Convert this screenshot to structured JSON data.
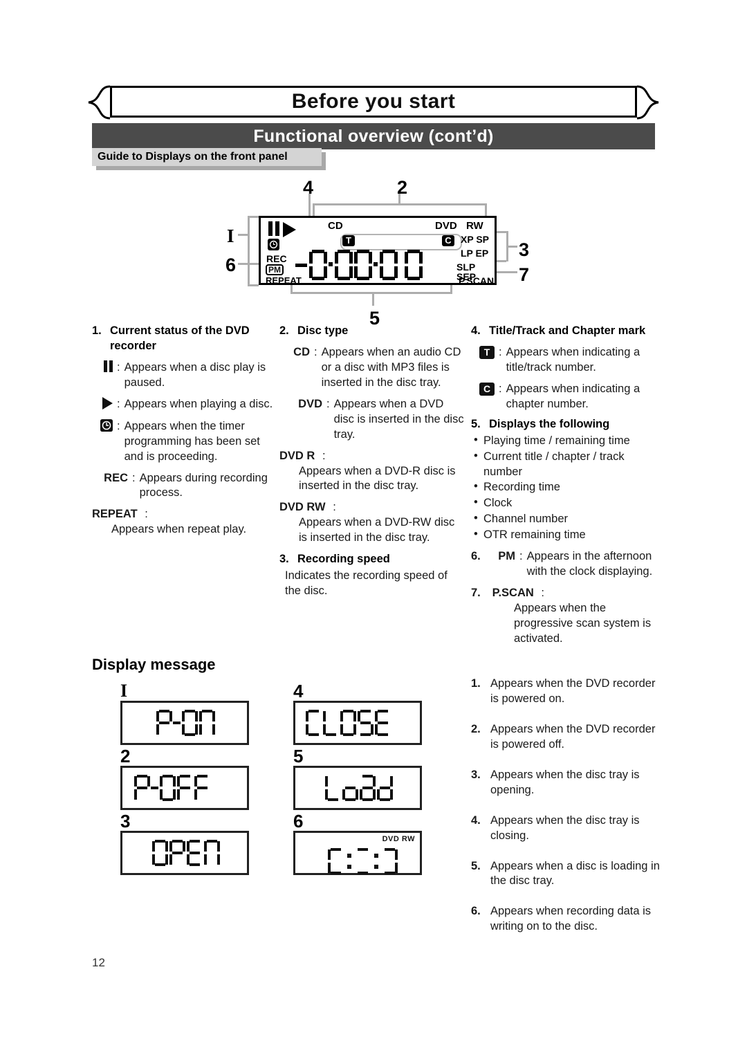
{
  "header": {
    "banner_title": "Before you start",
    "section_bar": "Functional overview (cont’d)",
    "tab_label": "Guide to Displays on the front panel"
  },
  "panel_diagram": {
    "callouts": {
      "one": "I",
      "two": "2",
      "three": "3",
      "four": "4",
      "five": "5",
      "six": "6",
      "seven": "7"
    },
    "labels": {
      "cd": "CD",
      "dvd": "DVD",
      "rw": "RW",
      "xp_sp": "XP SP",
      "lp_ep": "LP EP",
      "slp_sep": "SLP SEP",
      "pscan": "P.SCAN",
      "rec": "REC",
      "pm": "PM",
      "repeat": "REPEAT",
      "title_mark": "T",
      "chapter_mark": "C"
    }
  },
  "col_left": {
    "heading_num": "1.",
    "heading": "Current status of the DVD recorder",
    "items": [
      {
        "icon": "pause-icon",
        "sep": ":",
        "text": "Appears when a disc play is paused."
      },
      {
        "icon": "play-icon",
        "sep": ":",
        "text": "Appears when playing a disc."
      },
      {
        "icon": "clock-icon",
        "sep": ":",
        "text": "Appears when the timer programming has been set and is proceeding."
      }
    ],
    "rec_key": "REC",
    "rec_sep": ":",
    "rec_text": "Appears during recording process.",
    "repeat_key": "REPEAT",
    "repeat_sep": ":",
    "repeat_text": "Appears when repeat play."
  },
  "col_mid": {
    "heading_num": "2.",
    "heading": "Disc type",
    "cd_key": "CD",
    "cd_sep": ":",
    "cd_text": "Appears when an audio CD or a disc with MP3 files is inserted in the disc tray.",
    "dvd_key": "DVD",
    "dvd_sep": ":",
    "dvd_text": "Appears when a DVD disc is inserted in the disc tray.",
    "dvdr_key": "DVD  R",
    "dvdr_sep": ":",
    "dvdr_text": "Appears when a DVD-R disc is inserted in the disc tray.",
    "dvdrw_key": "DVD  RW",
    "dvdrw_sep": ":",
    "dvdrw_text": "Appears when a DVD-RW disc is inserted in the disc tray.",
    "rs_num": "3.",
    "rs_heading": "Recording speed",
    "rs_text": "Indicates the recording speed of the disc."
  },
  "col_right": {
    "heading_num": "4.",
    "heading": "Title/Track and Chapter mark",
    "t_key": "T",
    "t_sep": ":",
    "t_text": "Appears when indicating a title/track number.",
    "c_key": "C",
    "c_sep": ":",
    "c_text": "Appears when indicating a chapter number.",
    "five_num": "5.",
    "five_heading": "Displays the following",
    "five_bullets": [
      "Playing time / remaining time",
      "Current title / chapter / track number",
      "Recording time",
      "Clock",
      "Channel number",
      "OTR remaining time"
    ],
    "six_num": "6.",
    "six_key": "PM",
    "six_sep": ":",
    "six_text": "Appears in the afternoon with the clock displaying.",
    "seven_num": "7.",
    "seven_key": "P.SCAN",
    "seven_sep": ":",
    "seven_text": "Appears when the progressive scan system is activated."
  },
  "display_message": {
    "title": "Display message",
    "screens": [
      {
        "num": "I",
        "text": "P-ON"
      },
      {
        "num": "2",
        "text": "P-OFF"
      },
      {
        "num": "3",
        "text": "OPEN"
      },
      {
        "num": "4",
        "text": "CLOSE"
      },
      {
        "num": "5",
        "text": "Load"
      },
      {
        "num": "6",
        "text": "[::]",
        "badge": "DVD   RW"
      }
    ],
    "notes": [
      {
        "num": "1.",
        "text": "Appears when the DVD recorder is powered on."
      },
      {
        "num": "2.",
        "text": "Appears when the DVD recorder is powered off."
      },
      {
        "num": "3.",
        "text": "Appears when the disc tray is opening."
      },
      {
        "num": "4.",
        "text": "Appears when the disc tray is closing."
      },
      {
        "num": "5.",
        "text": "Appears when a disc is loading in the disc tray."
      },
      {
        "num": "6.",
        "text": "Appears when recording data is writing on to the disc."
      }
    ]
  },
  "footer": {
    "page_number": "12"
  }
}
